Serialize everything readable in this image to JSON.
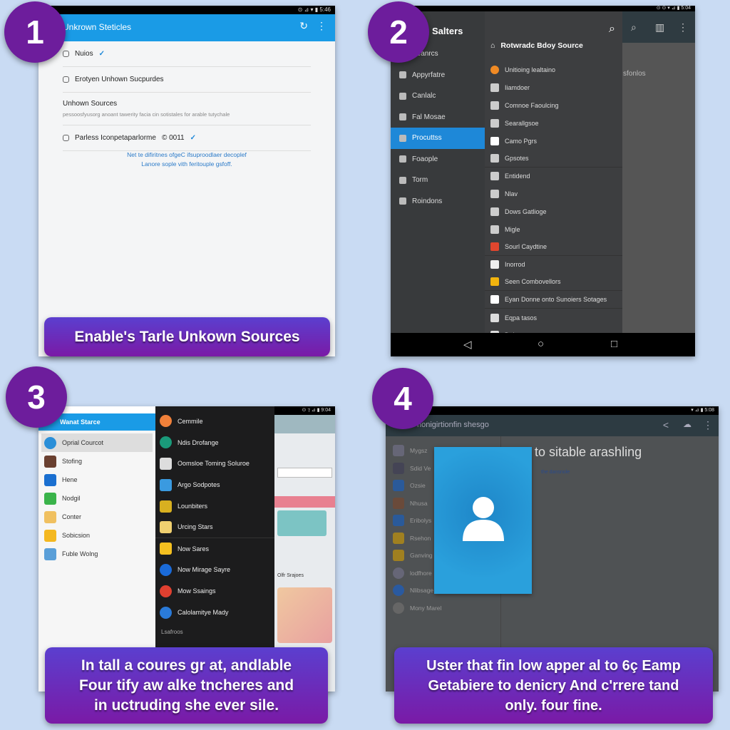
{
  "steps": [
    "1",
    "2",
    "3",
    "4"
  ],
  "panel1": {
    "status": "⊙ ⊿ ▾ ▮ 5:46",
    "title": "Unkrown Steticles",
    "items": [
      {
        "label": "Nuios",
        "check": true
      },
      {
        "label": "Erotyen Unhown Sucpurdes",
        "check": false
      },
      {
        "label": "Unhown Sources",
        "sub": "pessoosfyusorg anoant tawerity facia cin sotistales for arable tutychale"
      },
      {
        "label": "Parless Iconpetaparlorme",
        "extra": "© 0011",
        "check": true
      }
    ],
    "note": [
      "Net te difiritnes ofgeC ifsuproodlaer decoplef",
      "Lanore sople vith feritouple gsfoff."
    ],
    "caption": "Enable's Tarle Unkown Sources"
  },
  "panel2": {
    "status": "⊙ ⊙ ▾ ⊿ ▮ 5:04",
    "drawer_title": "Salters",
    "drawer": [
      "Seanrcs",
      "Appyrfatre",
      "Canlalc",
      "Fal Mosae",
      "Procuttss",
      "Foaople",
      "Torm",
      "Roindons"
    ],
    "selected": 4,
    "header": "Rotwradc Bdoy Source",
    "menu": [
      {
        "l": "Unitioing lealtaino",
        "c": "#f08a24"
      },
      {
        "l": "Iiamdoer",
        "c": "#ccc"
      },
      {
        "l": "Comnoe Faoulcing",
        "c": "#ccc"
      },
      {
        "l": "Searallgsoe",
        "c": "#ccc"
      },
      {
        "l": "Camo Pgrs",
        "c": "#fff"
      },
      {
        "l": "Gpsotes",
        "c": "#ccc"
      },
      {
        "l": "Entidend",
        "c": "#ccc"
      },
      {
        "l": "Nlav",
        "c": "#ccc"
      },
      {
        "l": "Dows Gatlioge",
        "c": "#ccc"
      },
      {
        "l": "Migle",
        "c": "#ccc"
      },
      {
        "l": "Sourl Caydtine",
        "c": "#e0462e"
      },
      {
        "l": "Inorrod",
        "c": "#eee"
      },
      {
        "l": "Seen Combovellors",
        "c": "#f2b40e"
      },
      {
        "l": "Eyan Donne onto Sunoiers Sotages",
        "c": "#fff"
      },
      {
        "l": "Eqpa tasos",
        "c": "#ddd"
      },
      {
        "l": "Daly",
        "c": "#ddd"
      }
    ],
    "bg_text": "sfonlos"
  },
  "panel3": {
    "status": "⊙ ⁊ ⊿ ▮ 9:04",
    "title": "Wanat Starce",
    "left": [
      {
        "l": "Oprial Courcot",
        "c": "#2a8fd8"
      },
      {
        "l": "Stofing",
        "c": "#6a4030"
      },
      {
        "l": "Hene",
        "c": "#1a6fd0"
      },
      {
        "l": "Nodgil",
        "c": "#3ab34a"
      },
      {
        "l": "Conter",
        "c": "#f0c060"
      },
      {
        "l": "Sobicsion",
        "c": "#f4b820"
      },
      {
        "l": "Fuble Wolng",
        "c": "#5a9fd8"
      }
    ],
    "menu": [
      {
        "l": "Cemmile",
        "c": "#f0803a"
      },
      {
        "l": "Ndis Drofange",
        "c": "#1a9a7a"
      },
      {
        "l": "Oomsloe Toming Soluroe",
        "c": "#ddd"
      },
      {
        "l": "Argo Sodpotes",
        "c": "#3a9ae0"
      },
      {
        "l": "Lounbiters",
        "c": "#d8b020"
      },
      {
        "l": "Urcing Stars",
        "c": "#f0d070"
      },
      {
        "l": "Now Sares",
        "c": "#f4c020"
      },
      {
        "l": "Now Mirage Sayre",
        "c": "#1a6ad8"
      },
      {
        "l": "Mow Ssaings",
        "c": "#e04030"
      },
      {
        "l": "Calolamitye Mady",
        "c": "#2a7ad8"
      }
    ],
    "section": "Lsafroos",
    "right_label": "Olfr Srajoes",
    "caption": [
      "In tall a coures gr at, andlable",
      "Four tify aw alke tncheres and",
      "in uctruding she ever sile."
    ]
  },
  "panel4": {
    "status": "▾ ⊿ ▮ 5:08",
    "title": "nonigirtionfin shesgo",
    "heading": "to sitable arashling",
    "subtext": "the dansnole",
    "side": [
      {
        "l": "Mygsz",
        "c": "#667"
      },
      {
        "l": "Sdid Ve",
        "c": "#445"
      },
      {
        "l": "Ozsie",
        "c": "#2a5a9a"
      },
      {
        "l": "Nhusa",
        "c": "#6a4a3a"
      },
      {
        "l": "Eribolys",
        "c": "#2a5a9a"
      },
      {
        "l": "Rsehon",
        "c": "#a08020"
      },
      {
        "l": "Ganving",
        "c": "#a08020"
      },
      {
        "l": "lodfhore",
        "c": "#667"
      },
      {
        "l": "Nlibsage",
        "c": "#2a5aa0"
      },
      {
        "l": "Mony Marel",
        "c": "#666"
      }
    ],
    "caption": [
      "Uster that fin low apper al to 6ç Eamp",
      "Getabiere to denicry And c'rrere tand",
      "only. four fine."
    ]
  },
  "colors": {
    "badge": "#6d1d9c",
    "appbar_blue": "#1a9be6",
    "accent": "#1e88d8",
    "card_blue": "#2a9ad8"
  }
}
